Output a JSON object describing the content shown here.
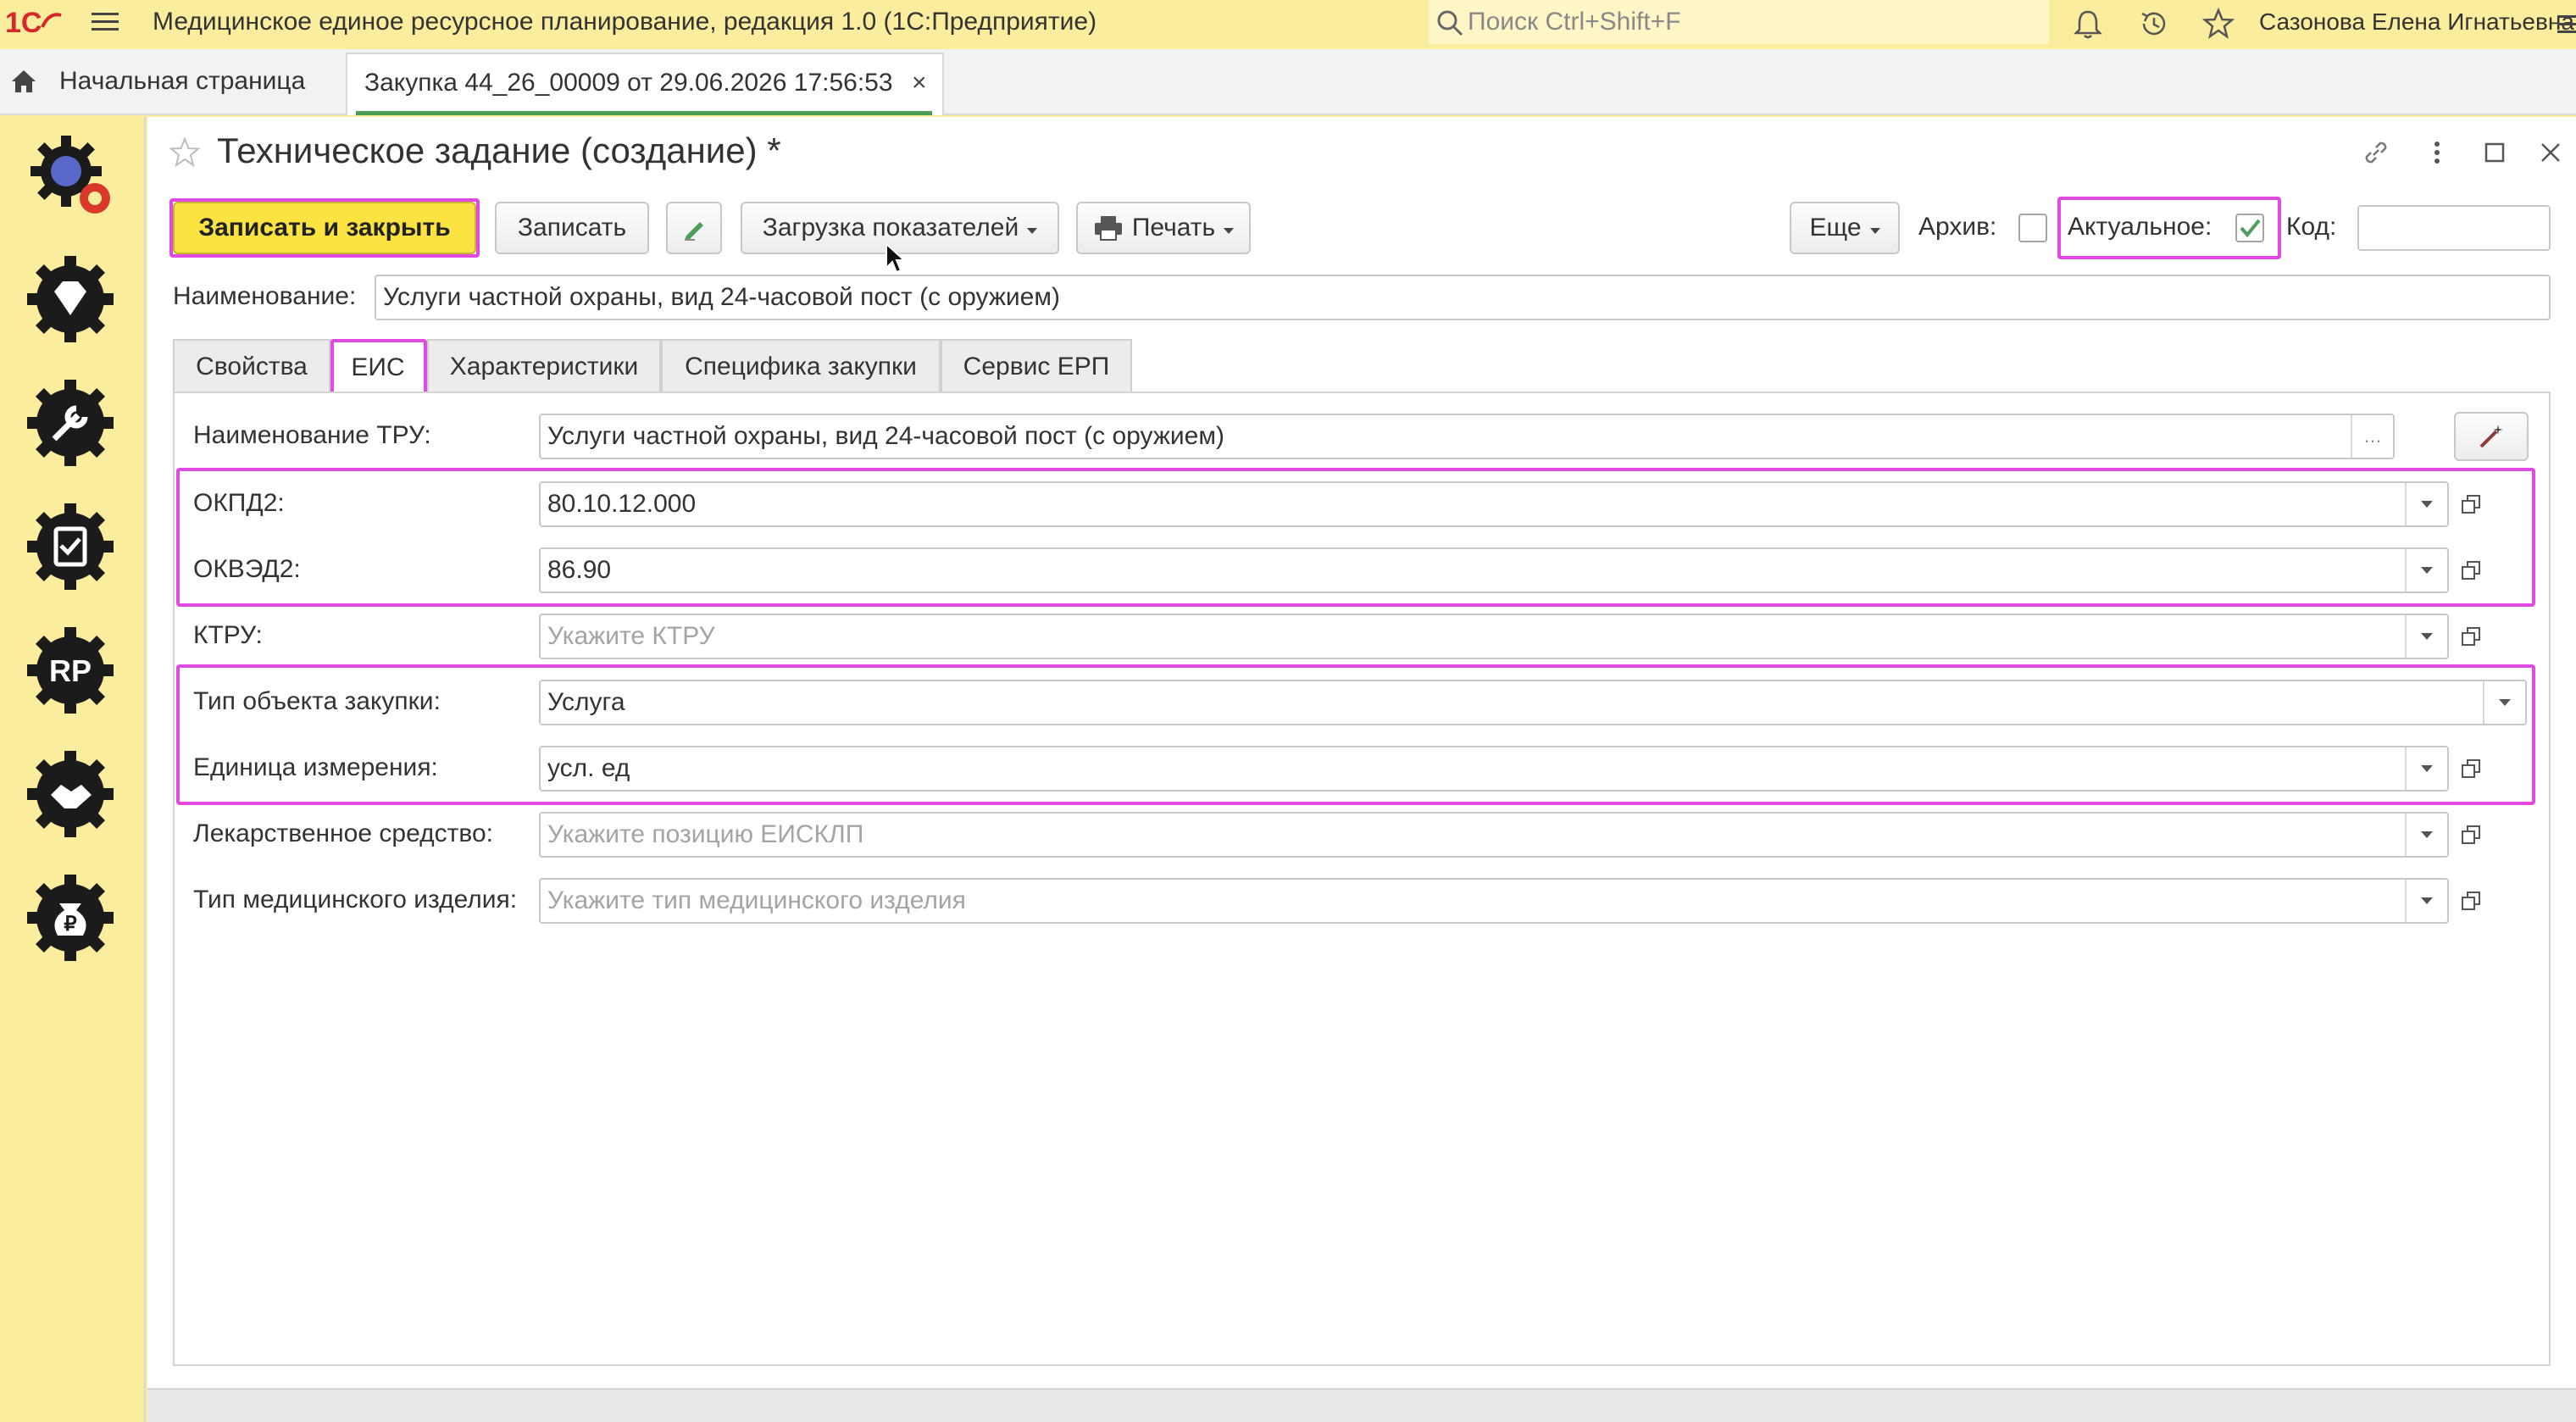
{
  "app": {
    "title": "Медицинское единое ресурсное планирование, редакция 1.0  (1С:Предприятие)",
    "search_placeholder": "Поиск Ctrl+Shift+F",
    "user": "Сазонова Елена Игнатьевна"
  },
  "tabs": {
    "home": "Начальная страница",
    "document": "Закупка 44_26_00009 от 29.06.2026 17:56:53"
  },
  "sidebar": {
    "icons": [
      "settings-gear-icon",
      "diamond-gear-icon",
      "tools-gear-icon",
      "checklist-gear-icon",
      "rp-gear-icon",
      "handshake-gear-icon",
      "ruble-bag-gear-icon"
    ]
  },
  "form": {
    "title": "Техническое задание (создание) *",
    "toolbar": {
      "save_close": "Записать и закрыть",
      "save": "Записать",
      "load_indicators": "Загрузка показателей",
      "print": "Печать",
      "more": "Еще",
      "archive_label": "Архив:",
      "actual_label": "Актуальное:",
      "code_label": "Код:"
    },
    "name_label": "Наименование:",
    "name_value": "Услуги частной охраны, вид 24-часовой пост (с оружием)",
    "tabs": [
      "Свойства",
      "ЕИС",
      "Характеристики",
      "Специфика закупки",
      "Сервис ЕРП"
    ],
    "active_tab": "ЕИС",
    "fields": [
      {
        "label": "Наименование ТРУ:",
        "value": "Услуги частной охраны, вид 24-часовой пост (с оружием)",
        "placeholder": ""
      },
      {
        "label": "ОКПД2:",
        "value": "80.10.12.000",
        "placeholder": ""
      },
      {
        "label": "ОКВЭД2:",
        "value": "86.90",
        "placeholder": ""
      },
      {
        "label": "КТРУ:",
        "value": "",
        "placeholder": "Укажите КТРУ"
      },
      {
        "label": "Тип объекта закупки:",
        "value": "Услуга",
        "placeholder": ""
      },
      {
        "label": "Единица измерения:",
        "value": "усл. ед",
        "placeholder": ""
      },
      {
        "label": "Лекарственное средство:",
        "value": "",
        "placeholder": "Укажите позицию ЕИСКЛП"
      },
      {
        "label": "Тип медицинского изделия:",
        "value": "",
        "placeholder": "Укажите тип медицинского изделия"
      }
    ]
  },
  "colors": {
    "top_bar": "#fbed9e",
    "primary_button": "#fbe342",
    "highlight": "#e04ae0",
    "active_tab_underline": "#4c9e59"
  }
}
